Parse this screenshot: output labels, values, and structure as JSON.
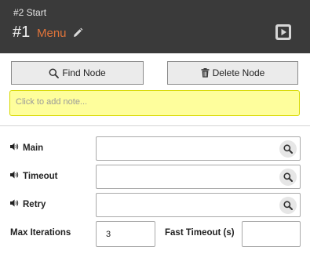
{
  "header": {
    "subtitle": "#2 Start",
    "number": "#1",
    "name": "Menu",
    "icons": [
      "pencil-icon",
      "play-icon"
    ]
  },
  "toolbar": {
    "find_label": "Find Node",
    "delete_label": "Delete Node",
    "find_icon": "search-icon",
    "delete_icon": "trash-icon"
  },
  "note": {
    "placeholder": "Click to add note..."
  },
  "fields": [
    {
      "label": "Main",
      "value": "",
      "icon": "speaker-icon"
    },
    {
      "label": "Timeout",
      "value": "",
      "icon": "speaker-icon"
    },
    {
      "label": "Retry",
      "value": "",
      "icon": "speaker-icon"
    }
  ],
  "settings": {
    "max_iterations_label": "Max Iterations",
    "max_iterations_value": "3",
    "fast_timeout_label": "Fast Timeout (s)",
    "fast_timeout_value": ""
  },
  "colors": {
    "header_bg": "#3a3a3a",
    "accent": "#e1743a",
    "note_bg": "#fefe9c"
  }
}
